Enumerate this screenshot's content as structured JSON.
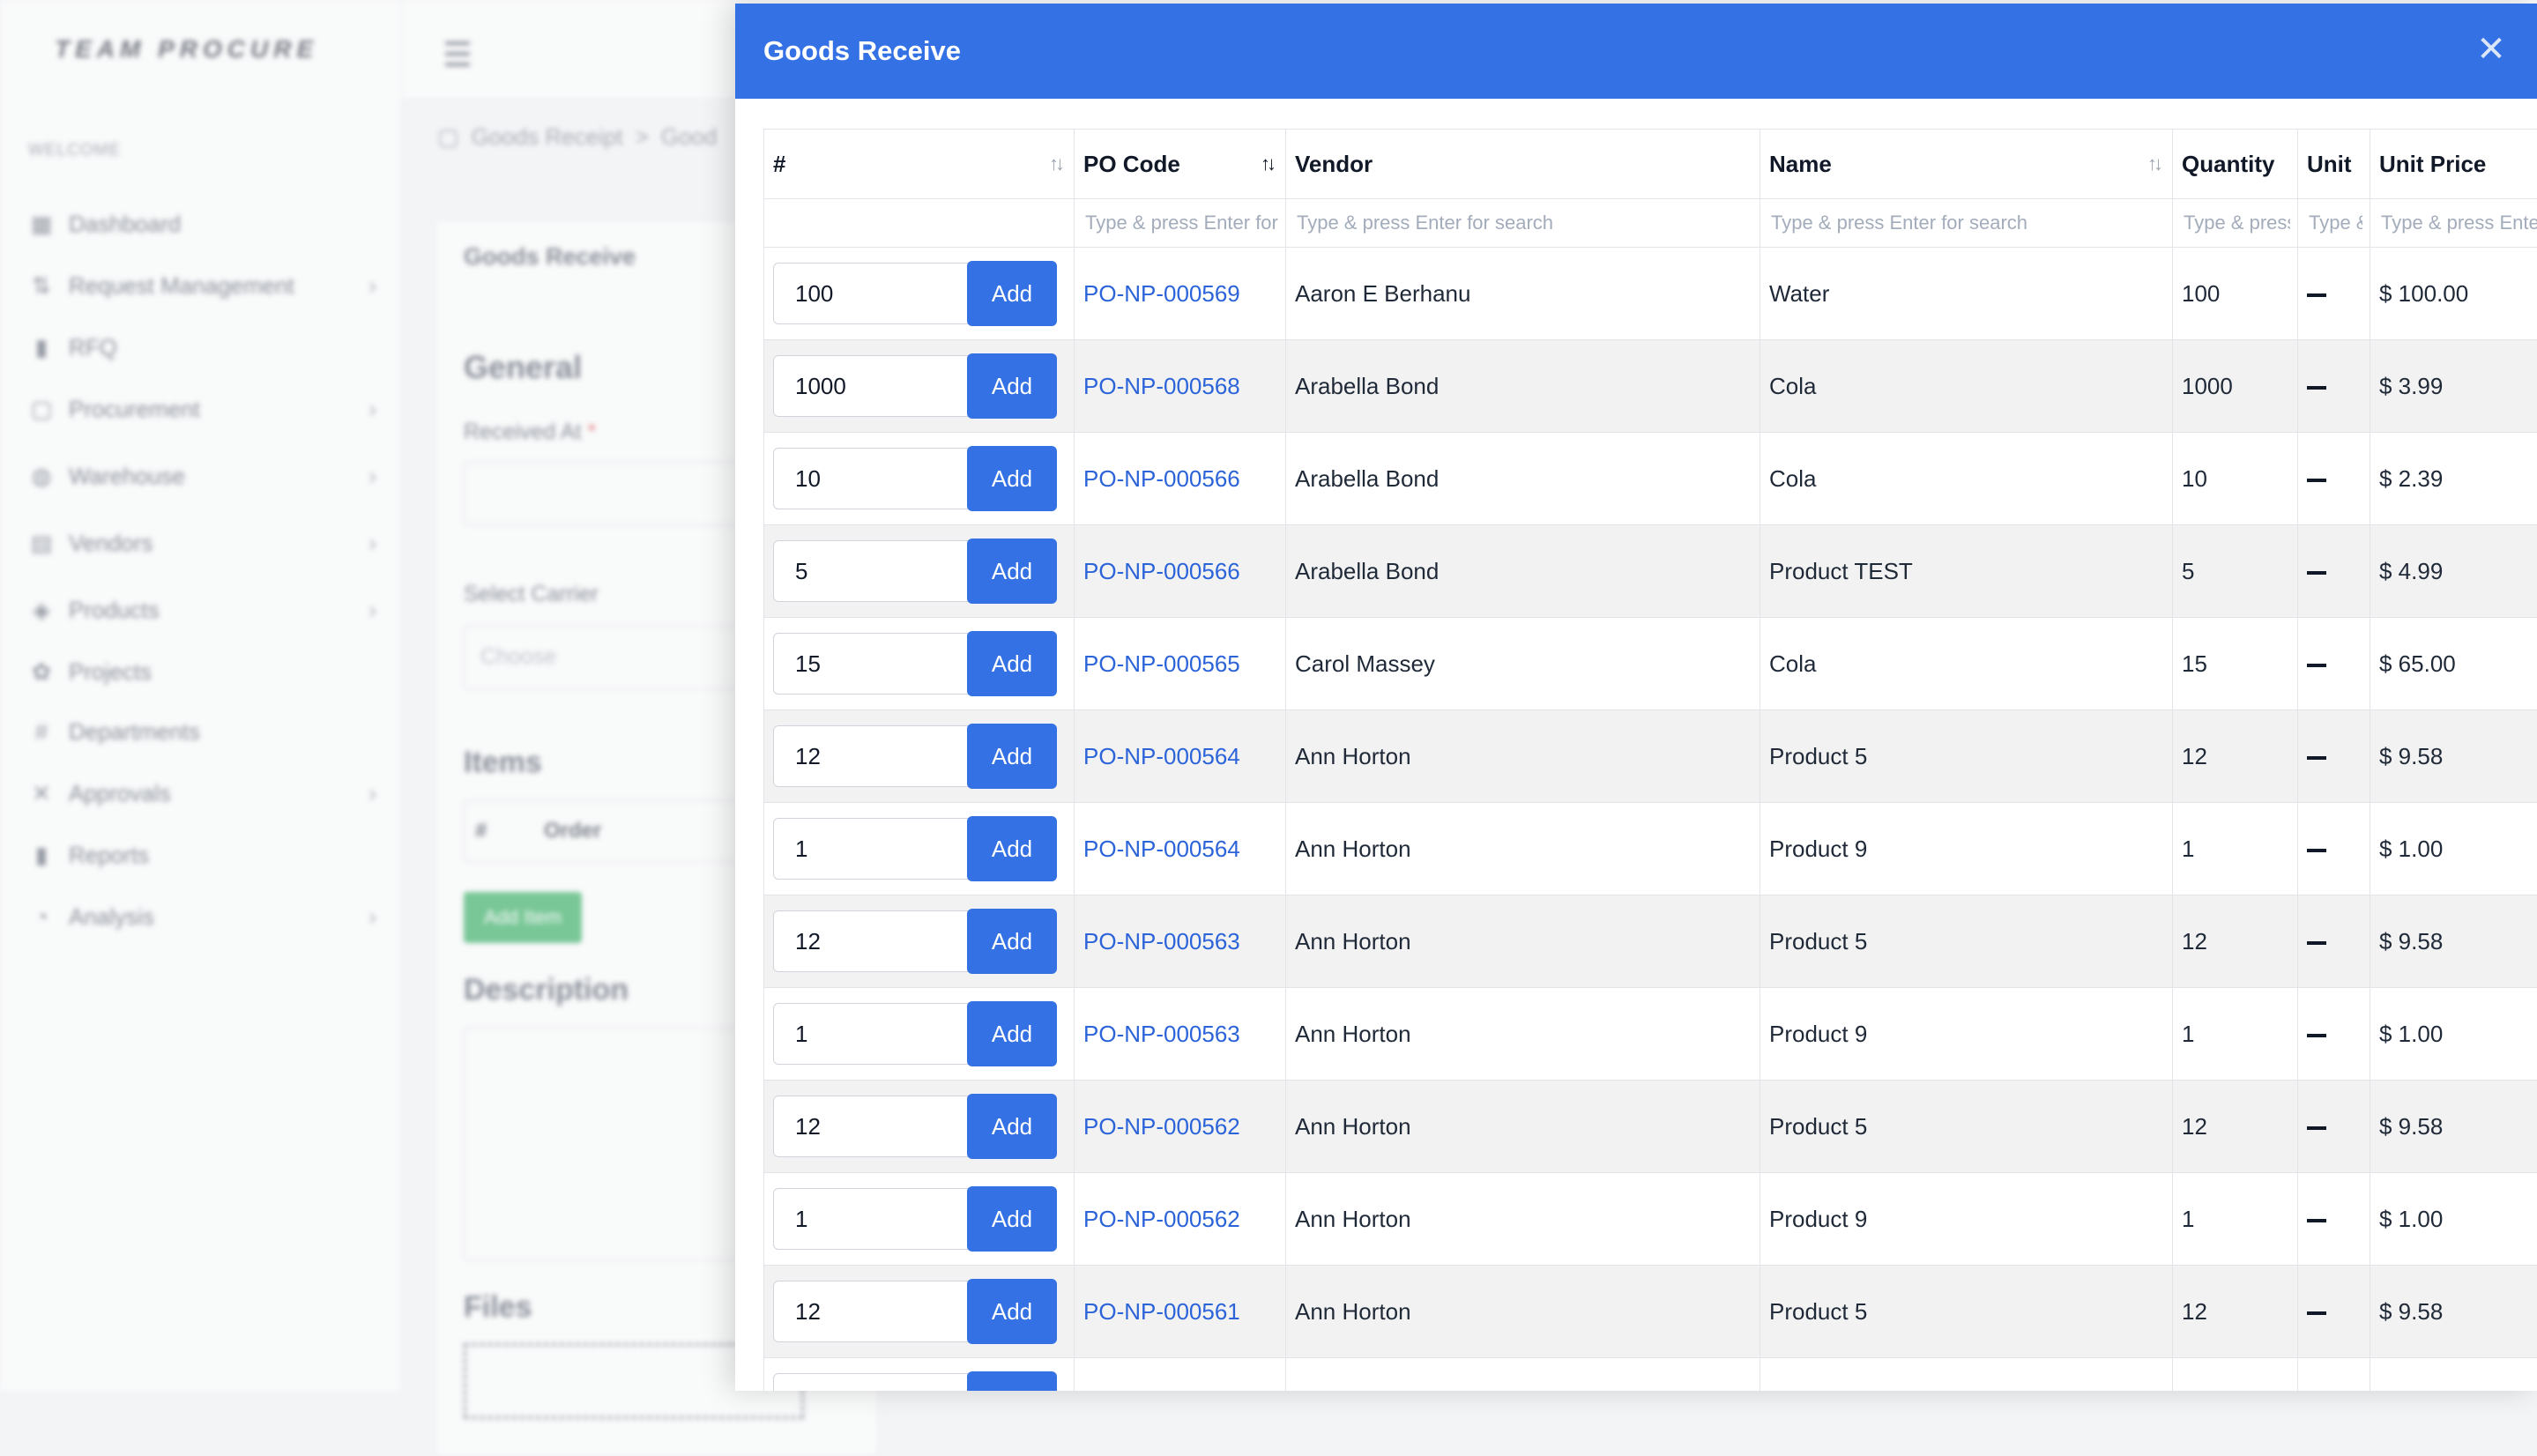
{
  "app": {
    "brand": "TEAM PROCURE",
    "welcome": "WELCOME"
  },
  "sidebar": {
    "items": [
      {
        "label": "Dashboard",
        "icon": "dashboard-icon",
        "glyph": "▦",
        "chevron": false
      },
      {
        "label": "Request Management",
        "icon": "request-icon",
        "glyph": "⇅",
        "chevron": true
      },
      {
        "label": "RFQ",
        "icon": "rfq-icon",
        "glyph": "▮",
        "chevron": false
      },
      {
        "label": "Procurement",
        "icon": "procurement-icon",
        "glyph": "▢",
        "chevron": true
      },
      {
        "label": "Warehouse",
        "icon": "warehouse-icon",
        "glyph": "◍",
        "chevron": true
      },
      {
        "label": "Vendors",
        "icon": "vendors-icon",
        "glyph": "▤",
        "chevron": true
      },
      {
        "label": "Products",
        "icon": "products-icon",
        "glyph": "◈",
        "chevron": true
      },
      {
        "label": "Projects",
        "icon": "projects-icon",
        "glyph": "✿",
        "chevron": false
      },
      {
        "label": "Departments",
        "icon": "departments-icon",
        "glyph": "#",
        "chevron": false
      },
      {
        "label": "Approvals",
        "icon": "approvals-icon",
        "glyph": "✕",
        "chevron": true
      },
      {
        "label": "Reports",
        "icon": "reports-icon",
        "glyph": "▮",
        "chevron": false
      },
      {
        "label": "Analysis",
        "icon": "analysis-icon",
        "glyph": "◔",
        "chevron": true
      }
    ]
  },
  "breadcrumb": {
    "item1": "Goods Receipt",
    "separator": ">",
    "item2": "Good"
  },
  "background_form": {
    "card_title": "Goods Receive",
    "general": "General",
    "received_at": "Received At",
    "required_mark": "*",
    "select_carrier": "Select Carrier",
    "carrier_placeholder": "Choose",
    "items": "Items",
    "col_hash": "#",
    "col_order": "Order",
    "add_item": "Add Item",
    "description": "Description",
    "files": "Files"
  },
  "modal": {
    "title": "Goods Receive",
    "close_glyph": "✕",
    "columns": {
      "hash": "#",
      "po_code": "PO Code",
      "vendor": "Vendor",
      "name": "Name",
      "quantity": "Quantity",
      "unit": "Unit",
      "unit_price": "Unit Price"
    },
    "filters": {
      "po_code": "Type & press Enter for search",
      "vendor": "Type & press Enter for search",
      "name": "Type & press Enter for search",
      "quantity": "Type & press Enter for search",
      "unit": "Type & press Enter for search",
      "unit_price": "Type & press Enter for search"
    },
    "add_label": "Add",
    "rows": [
      {
        "qty_input": "100",
        "po": "PO-NP-000569",
        "vendor": "Aaron E Berhanu",
        "name": "Water",
        "quantity": "100",
        "price": "$ 100.00"
      },
      {
        "qty_input": "1000",
        "po": "PO-NP-000568",
        "vendor": "Arabella Bond",
        "name": "Cola",
        "quantity": "1000",
        "price": "$ 3.99"
      },
      {
        "qty_input": "10",
        "po": "PO-NP-000566",
        "vendor": "Arabella Bond",
        "name": "Cola",
        "quantity": "10",
        "price": "$ 2.39"
      },
      {
        "qty_input": "5",
        "po": "PO-NP-000566",
        "vendor": "Arabella Bond",
        "name": "Product TEST",
        "quantity": "5",
        "price": "$ 4.99"
      },
      {
        "qty_input": "15",
        "po": "PO-NP-000565",
        "vendor": "Carol Massey",
        "name": "Cola",
        "quantity": "15",
        "price": "$ 65.00"
      },
      {
        "qty_input": "12",
        "po": "PO-NP-000564",
        "vendor": "Ann Horton",
        "name": "Product 5",
        "quantity": "12",
        "price": "$ 9.58"
      },
      {
        "qty_input": "1",
        "po": "PO-NP-000564",
        "vendor": "Ann Horton",
        "name": "Product 9",
        "quantity": "1",
        "price": "$ 1.00"
      },
      {
        "qty_input": "12",
        "po": "PO-NP-000563",
        "vendor": "Ann Horton",
        "name": "Product 5",
        "quantity": "12",
        "price": "$ 9.58"
      },
      {
        "qty_input": "1",
        "po": "PO-NP-000563",
        "vendor": "Ann Horton",
        "name": "Product 9",
        "quantity": "1",
        "price": "$ 1.00"
      },
      {
        "qty_input": "12",
        "po": "PO-NP-000562",
        "vendor": "Ann Horton",
        "name": "Product 5",
        "quantity": "12",
        "price": "$ 9.58"
      },
      {
        "qty_input": "1",
        "po": "PO-NP-000562",
        "vendor": "Ann Horton",
        "name": "Product 9",
        "quantity": "1",
        "price": "$ 1.00"
      },
      {
        "qty_input": "12",
        "po": "PO-NP-000561",
        "vendor": "Ann Horton",
        "name": "Product 5",
        "quantity": "12",
        "price": "$ 9.58"
      }
    ]
  },
  "colors": {
    "primary": "#3471e4",
    "link": "#2b63d9",
    "row_alt": "#f2f2f2"
  }
}
